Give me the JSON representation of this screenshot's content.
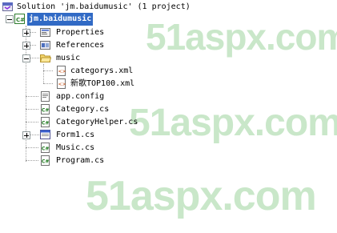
{
  "watermark": {
    "text_1": "51aspx.com",
    "text_2": "51aspx.com",
    "text_3": "51aspx.com"
  },
  "tree": {
    "solution_label": "Solution 'jm.baidumusic' (1 project)",
    "project_label": "jm.baidumusic",
    "items": {
      "properties": "Properties",
      "references": "References",
      "music_folder": "music",
      "categorys_xml": "categorys.xml",
      "top100_xml": "新歌TOP100.xml",
      "app_config": "app.config",
      "category_cs": "Category.cs",
      "category_helper_cs": "CategoryHelper.cs",
      "form1_cs": "Form1.cs",
      "music_cs": "Music.cs",
      "program_cs": "Program.cs"
    }
  },
  "colors": {
    "selection": "#316ac5",
    "watermark": "#c9e7c9",
    "tree_lines": "#a0a0a0"
  }
}
